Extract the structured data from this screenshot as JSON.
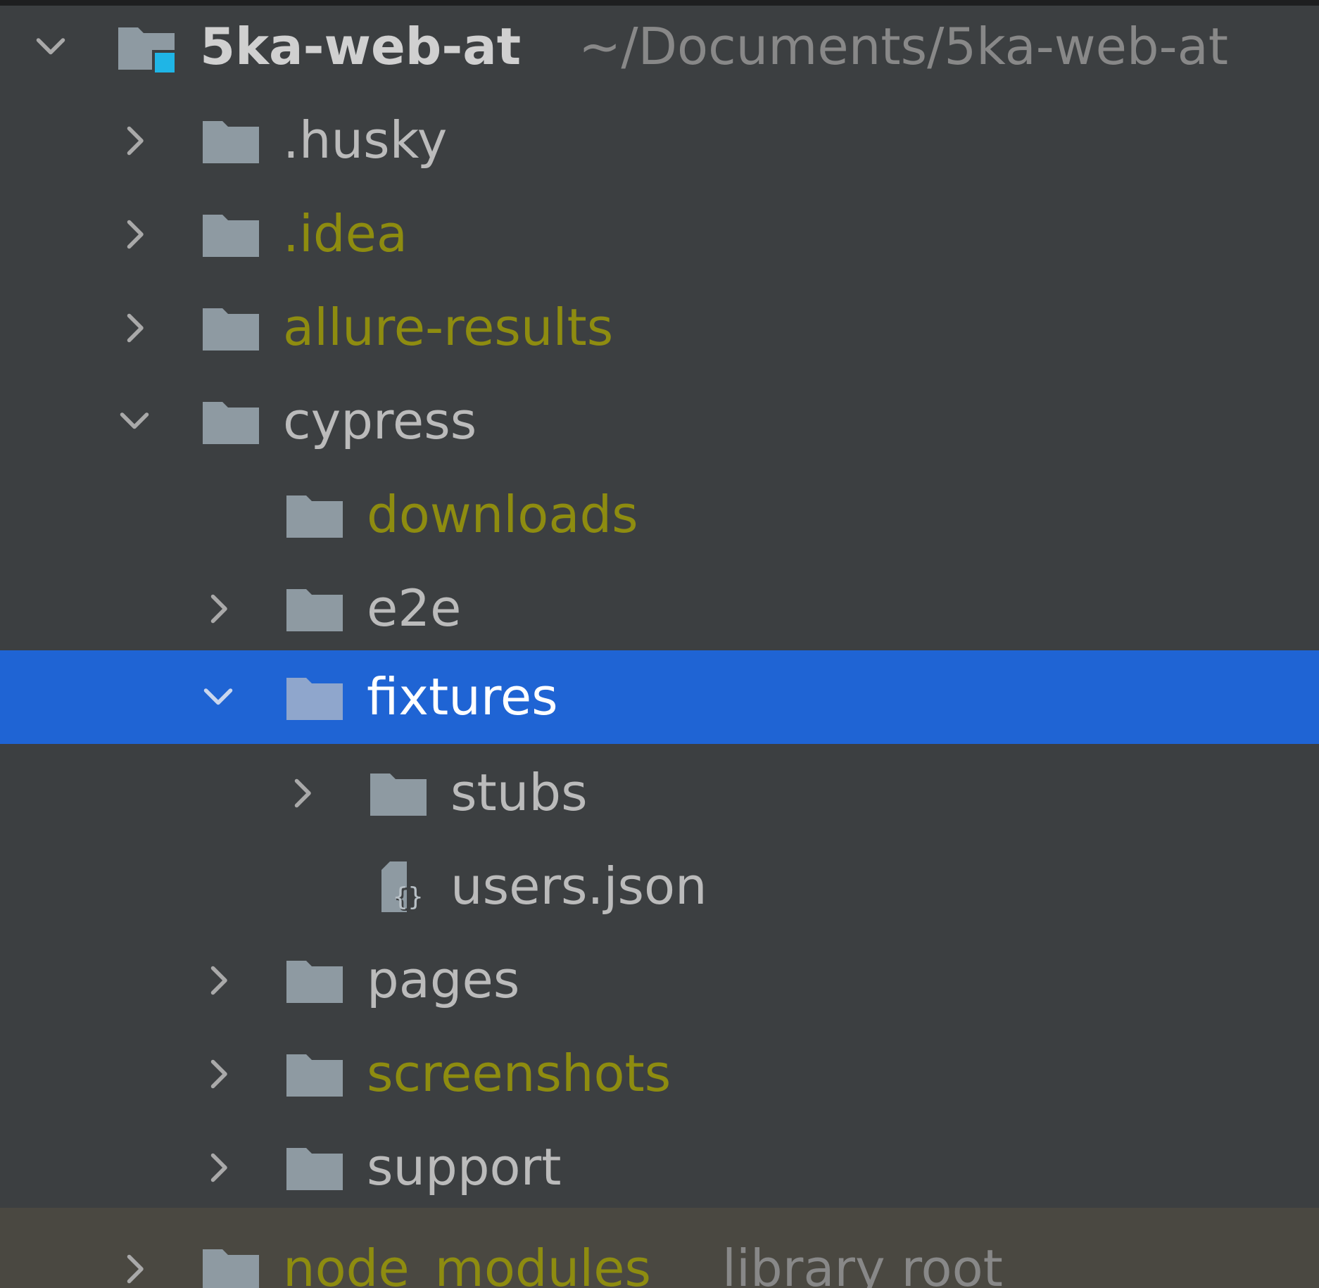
{
  "colors": {
    "background": "#3c3f41",
    "selection": "#1f64d4",
    "library_row": "#4a4841",
    "text_default": "#bbbbbb",
    "text_ignored": "#8e8c10",
    "text_hint": "#888888",
    "folder_icon": "#8e9aa2",
    "module_badge": "#1fb5e6"
  },
  "project_tree": {
    "root": {
      "name": "5ka-web-at",
      "path": "~/Documents/5ka-web-at",
      "expanded": true,
      "icon": "module-folder-icon"
    },
    "items": [
      {
        "label": ".husky",
        "expanded": false,
        "ignored": false,
        "icon": "folder-icon"
      },
      {
        "label": ".idea",
        "expanded": false,
        "ignored": true,
        "icon": "folder-icon"
      },
      {
        "label": "allure-results",
        "expanded": false,
        "ignored": true,
        "icon": "folder-icon"
      },
      {
        "label": "cypress",
        "expanded": true,
        "ignored": false,
        "icon": "folder-icon"
      },
      {
        "label": "downloads",
        "ignored": true,
        "icon": "folder-icon"
      },
      {
        "label": "e2e",
        "expanded": false,
        "ignored": false,
        "icon": "folder-icon"
      },
      {
        "label": "fixtures",
        "expanded": true,
        "selected": true,
        "icon": "folder-icon"
      },
      {
        "label": "stubs",
        "expanded": false,
        "ignored": false,
        "icon": "folder-icon"
      },
      {
        "label": "users.json",
        "ignored": false,
        "icon": "json-file-icon"
      },
      {
        "label": "pages",
        "expanded": false,
        "ignored": false,
        "icon": "folder-icon"
      },
      {
        "label": "screenshots",
        "expanded": false,
        "ignored": true,
        "icon": "folder-icon"
      },
      {
        "label": "support",
        "expanded": false,
        "ignored": false,
        "icon": "folder-icon"
      },
      {
        "label": "node_modules",
        "hint": "library root",
        "expanded": false,
        "ignored": true,
        "icon": "folder-icon"
      }
    ]
  }
}
